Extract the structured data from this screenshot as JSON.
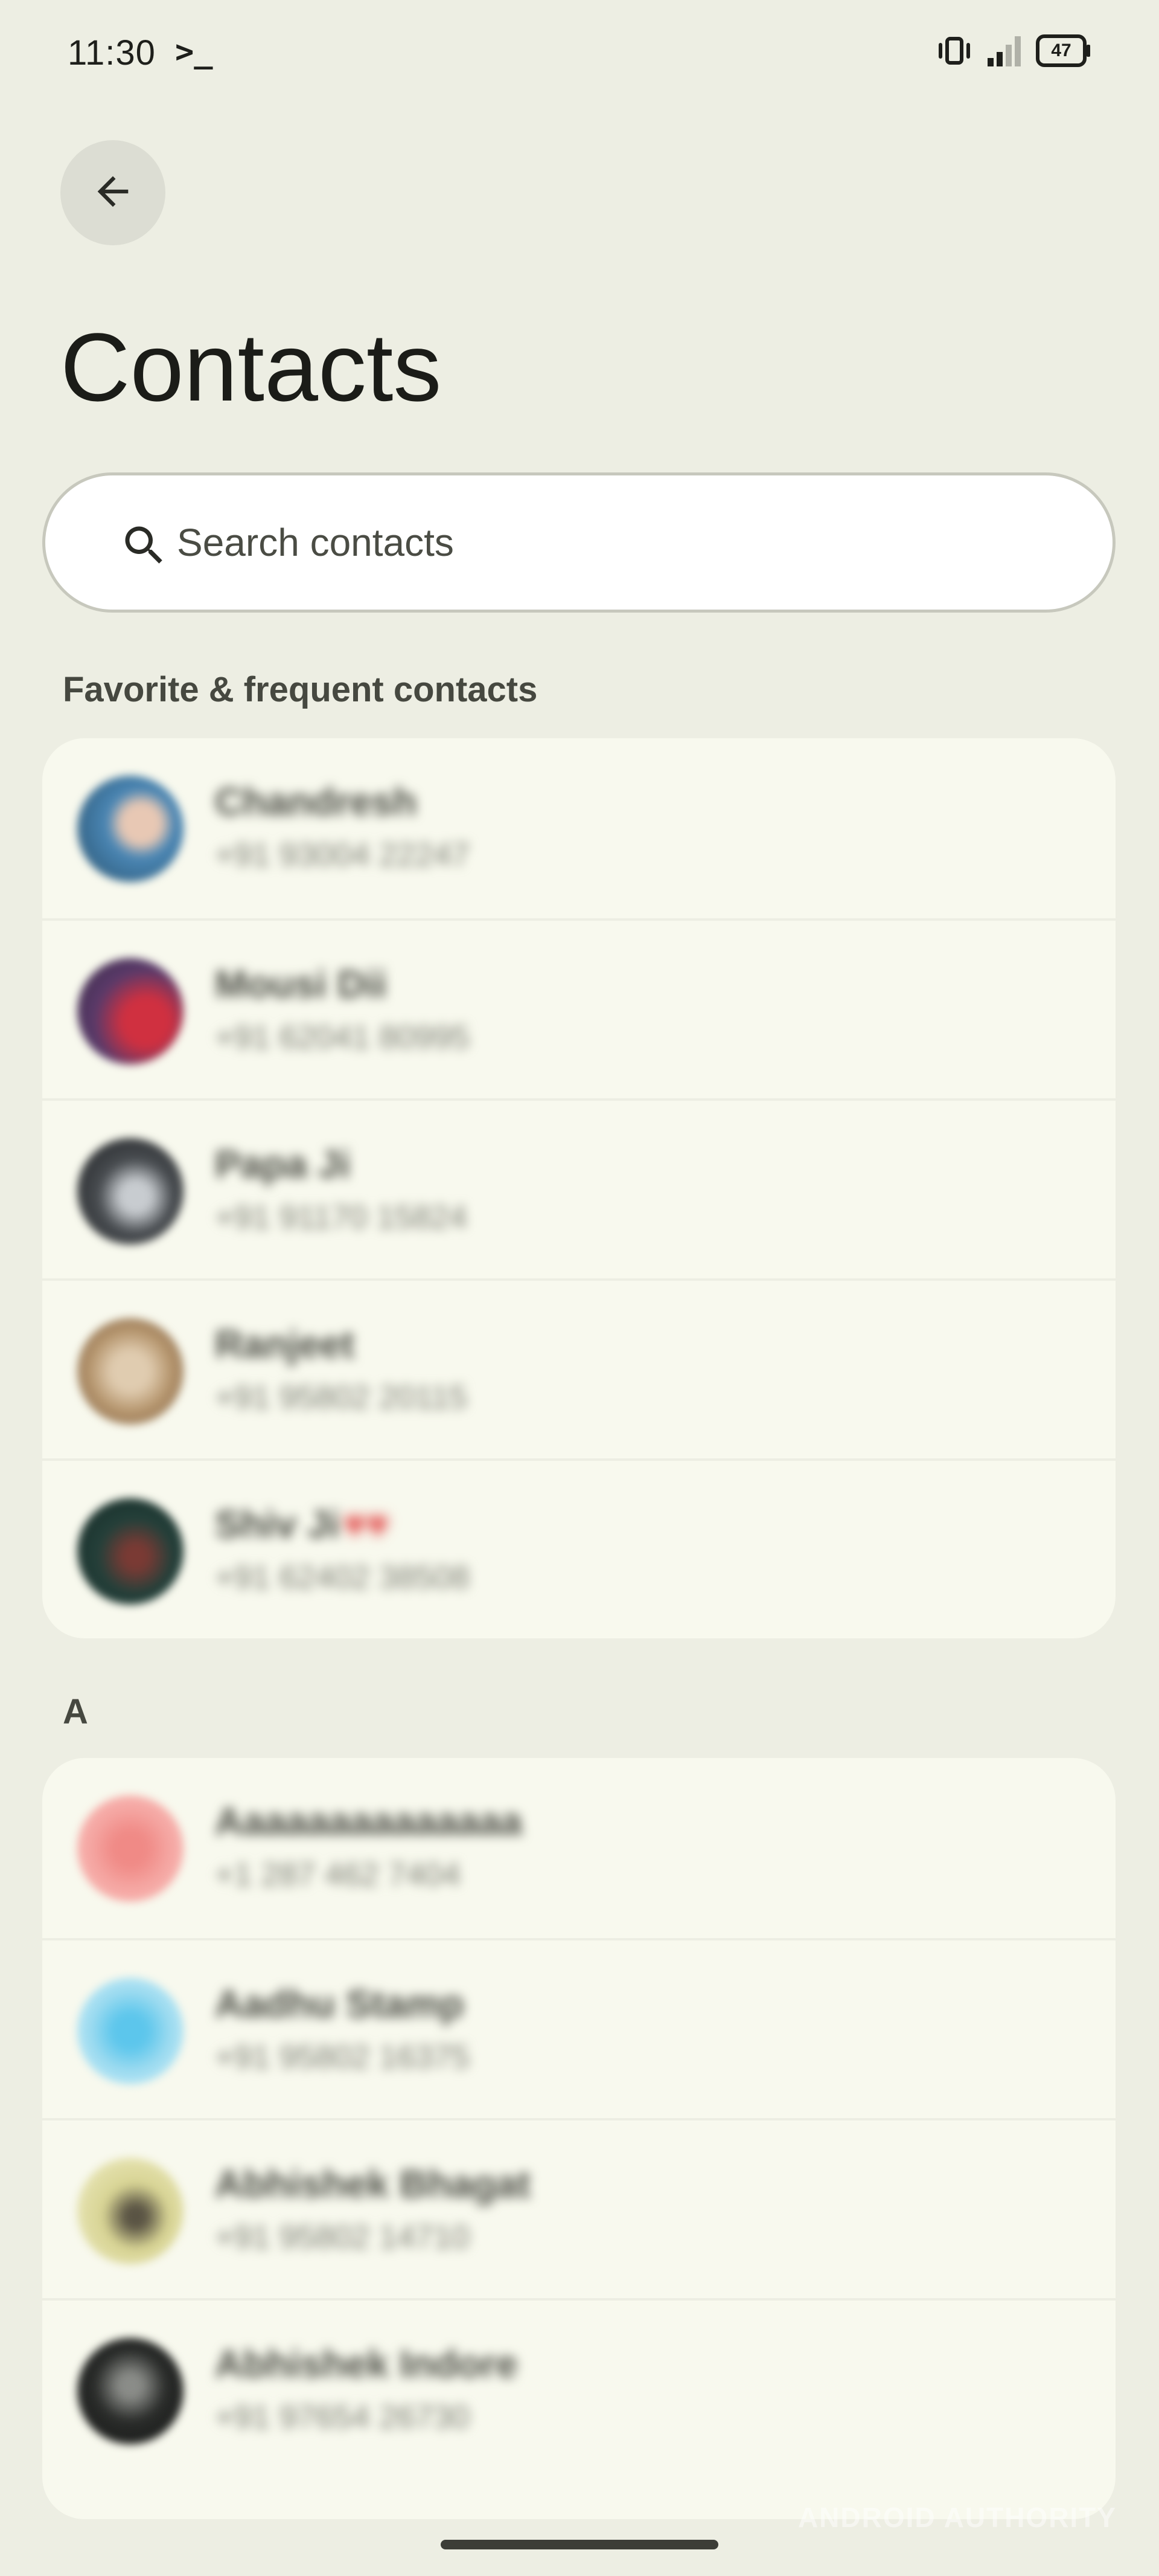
{
  "status_bar": {
    "time": "11:30",
    "terminal_glyph": ">_",
    "battery": "47"
  },
  "header": {
    "title": "Contacts"
  },
  "search": {
    "placeholder": "Search contacts",
    "value": ""
  },
  "sections": {
    "favorites_label": "Favorite & frequent contacts",
    "a_label": "A"
  },
  "favorites": [
    {
      "name": "Chandresh",
      "phone": "+91 93004 22247",
      "avatar_color": "#4a86b4"
    },
    {
      "name": "Mousi Dii",
      "phone": "+91 62041 80995",
      "avatar_color": "#7c3848"
    },
    {
      "name": "Papa Ji",
      "phone": "+91 91170 15824",
      "avatar_color": "#34383c"
    },
    {
      "name": "Ranjeet",
      "phone": "+91 95802 20115",
      "avatar_color": "#b4946c"
    },
    {
      "name": "Shiv Ji",
      "phone": "+91 62402 38508",
      "avatar_color": "#24403a"
    }
  ],
  "a_contacts": [
    {
      "name": "Aaaaaaaaaaaaaa",
      "phone": "+1 287 462 7404",
      "avatar_color": "#f5a8a4"
    },
    {
      "name": "Aadhu Stamp",
      "phone": "+91 95802 16375",
      "avatar_color": "#a0dcf0"
    },
    {
      "name": "Abhishek Bhagat",
      "phone": "+91 95802 14710",
      "avatar_color": "#d8d494"
    },
    {
      "name": "Abhishek Indore",
      "phone": "+91 97654 26730",
      "avatar_color": "#2a2c2a"
    }
  ],
  "watermark": "ANDROID AUTHORITY",
  "colors": {
    "background": "#edeee3",
    "card": "#f8f9ee",
    "heart": "#e04040"
  }
}
